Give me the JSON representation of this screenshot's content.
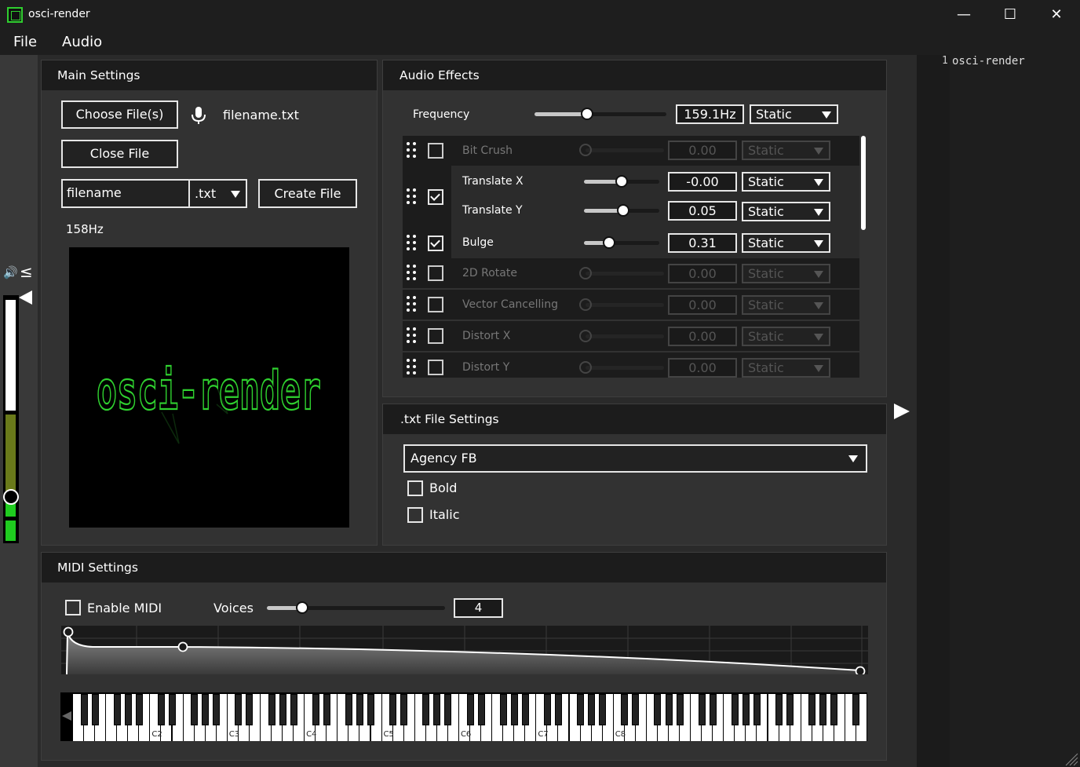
{
  "window": {
    "title": "osci-render",
    "min_glyph": "—",
    "max_glyph": "☐",
    "close_glyph": "✕"
  },
  "menu": [
    "File",
    "Audio"
  ],
  "code_editor": {
    "line_number": "1",
    "text": "osci-render"
  },
  "main_settings": {
    "title": "Main Settings",
    "choose_files_label": "Choose File(s)",
    "current_file": "filename.txt",
    "close_file_label": "Close File",
    "filename_value": "filename",
    "extension_value": ".txt",
    "create_file_label": "Create File",
    "frequency_display": "158Hz",
    "visualiser_text": "osci-render",
    "visualiser_color": "#2fd12f"
  },
  "audio_effects": {
    "title": "Audio Effects",
    "frequency": {
      "label": "Frequency",
      "value": "159.1Hz",
      "mode": "Static",
      "level": 0.4
    },
    "effects": [
      {
        "label": "Bit Crush",
        "enabled": false,
        "value": "0.00",
        "mode": "Static",
        "level": 0.0
      },
      {
        "label": "Translate X",
        "enabled": true,
        "value": "-0.00",
        "mode": "Static",
        "level": 0.5
      },
      {
        "label": "Translate Y",
        "enabled": true,
        "value": "0.05",
        "mode": "Static",
        "level": 0.52
      },
      {
        "label": "Bulge",
        "enabled": true,
        "value": "0.31",
        "mode": "Static",
        "level": 0.33
      },
      {
        "label": "2D Rotate",
        "enabled": false,
        "value": "0.00",
        "mode": "Static",
        "level": 0.0
      },
      {
        "label": "Vector Cancelling",
        "enabled": false,
        "value": "0.00",
        "mode": "Static",
        "level": 0.0
      },
      {
        "label": "Distort X",
        "enabled": false,
        "value": "0.00",
        "mode": "Static",
        "level": 0.0
      },
      {
        "label": "Distort Y",
        "enabled": false,
        "value": "0.00",
        "mode": "Static",
        "level": 0.0
      }
    ]
  },
  "txt_settings": {
    "title": ".txt File Settings",
    "font": "Agency FB",
    "bold_label": "Bold",
    "bold": false,
    "italic_label": "Italic",
    "italic": false
  },
  "midi_settings": {
    "title": "MIDI Settings",
    "enable_label": "Enable MIDI",
    "enabled": false,
    "voices_label": "Voices",
    "voices_value": "4",
    "voices_level": 0.2,
    "octave_labels": [
      "C2",
      "C3",
      "C4",
      "C5",
      "C6",
      "C7",
      "C8"
    ]
  },
  "volume": {
    "speaker_glyph": "🔊",
    "threshold_glyph": "≤",
    "level": 0.27,
    "threshold": 1.0
  },
  "colors": {
    "accent_green": "#2fd12f",
    "meter_green": "#1fcc1f",
    "meter_olive": "#6a7a1a"
  }
}
